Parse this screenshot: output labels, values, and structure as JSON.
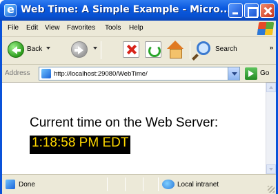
{
  "window": {
    "title": "Web Time: A Simple Example - Micro..."
  },
  "menu": {
    "items": [
      "File",
      "Edit",
      "View",
      "Favorites",
      "Tools",
      "Help"
    ]
  },
  "toolbar": {
    "back_label": "Back",
    "search_label": "Search",
    "overflow": "»"
  },
  "address": {
    "label": "Address",
    "url": "http://localhost:29080/WebTime/",
    "go_label": "Go"
  },
  "content": {
    "heading": "Current time on the Web Server:",
    "time": "1:18:58 PM EDT",
    "time_bg": "#000000",
    "time_fg": "#ffd800"
  },
  "status": {
    "text": "Done",
    "zone": "Local intranet"
  },
  "icons": {
    "app": "ie-icon",
    "back": "back-arrow-icon",
    "forward": "forward-arrow-icon",
    "stop": "stop-icon",
    "refresh": "refresh-icon",
    "home": "home-icon",
    "search": "search-icon",
    "go": "go-arrow-icon",
    "zone": "globe-icon"
  }
}
